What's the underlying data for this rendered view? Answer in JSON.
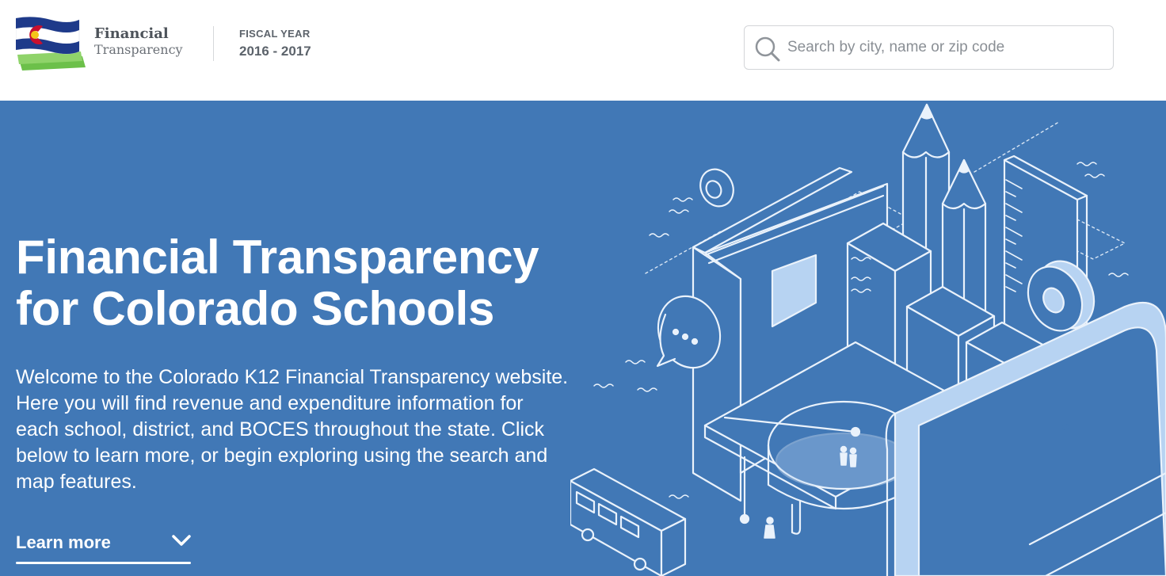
{
  "header": {
    "logo": {
      "line1": "Financial",
      "line2": "Transparency"
    },
    "fiscal_year": {
      "label": "FISCAL YEAR",
      "value": "2016 - 2017"
    },
    "search": {
      "placeholder": "Search by city, name or zip code",
      "icon": "search-icon"
    }
  },
  "hero": {
    "title_line1": "Financial Transparency",
    "title_line2": "for Colorado Schools",
    "intro": "Welcome to the Colorado K12 Financial Transparency website. Here you will find revenue and expenditure information for each school, district, and BOCES throughout the state. Click below to learn more, or begin exploring using the search and map features.",
    "learn_more": "Learn more",
    "learn_more_icon": "chevron-down-icon",
    "illustration": "isometric-school-illustration"
  },
  "colors": {
    "hero_background": "#4178b6",
    "illustration_line": "#eaf2fb",
    "illustration_fill": "#b7d3f2",
    "flag_blue": "#1e3a8a",
    "flag_red": "#c8102e",
    "flag_yellow": "#f5c518",
    "logo_green": "#6cc04a"
  }
}
